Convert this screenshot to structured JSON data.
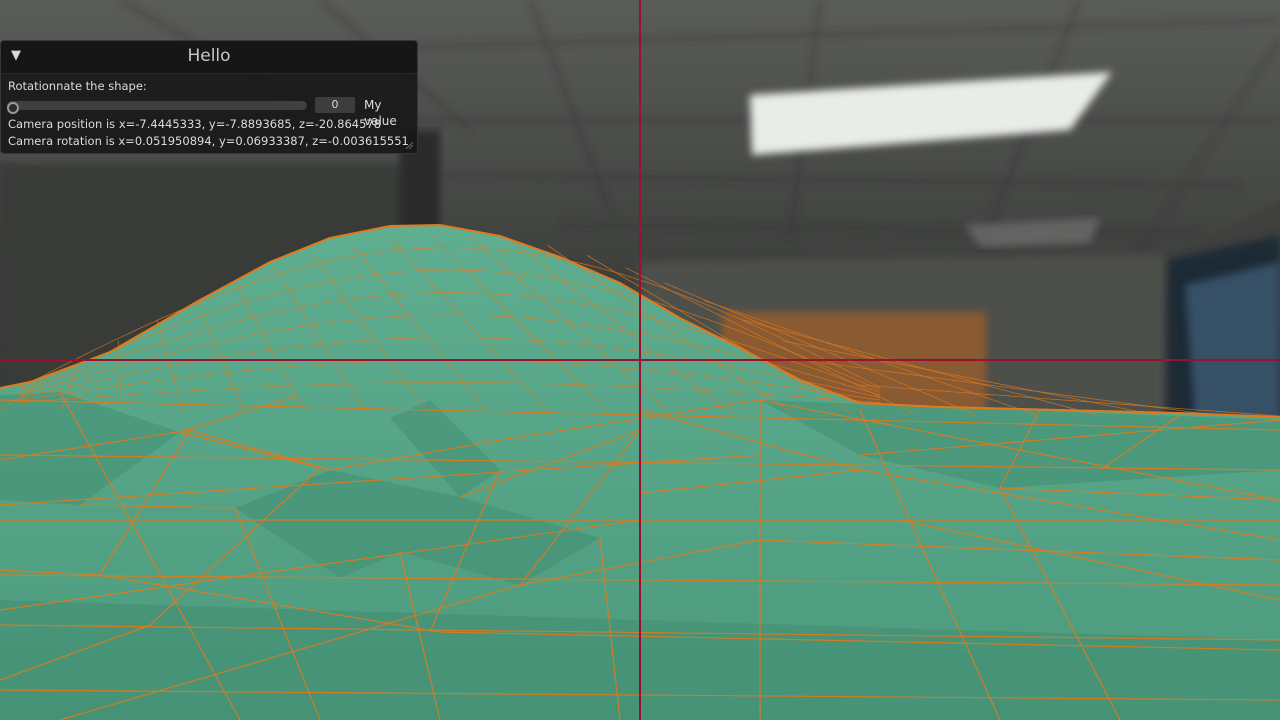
{
  "window": {
    "title": "Hello",
    "collapse_icon": "triangle-down-icon",
    "slider_label": "Rotationnate the shape:",
    "slider_value": "0",
    "slider_fraction": 0,
    "slider_name": "My value",
    "camera_position": "Camera position is x=-7.4445333, y=-7.8893685, z=-20.864578",
    "camera_rotation": "Camera rotation is x=0.051950894, y=0.06933387, z=-0.003615551"
  },
  "colors": {
    "mesh_fill": "#55a388",
    "wire": "#e07a1c",
    "crosshair": "#9a1030",
    "ceiling": "#4a4c4a",
    "wall": "#2e302f",
    "light": "#eef0ec",
    "door": "#8a5a32"
  }
}
